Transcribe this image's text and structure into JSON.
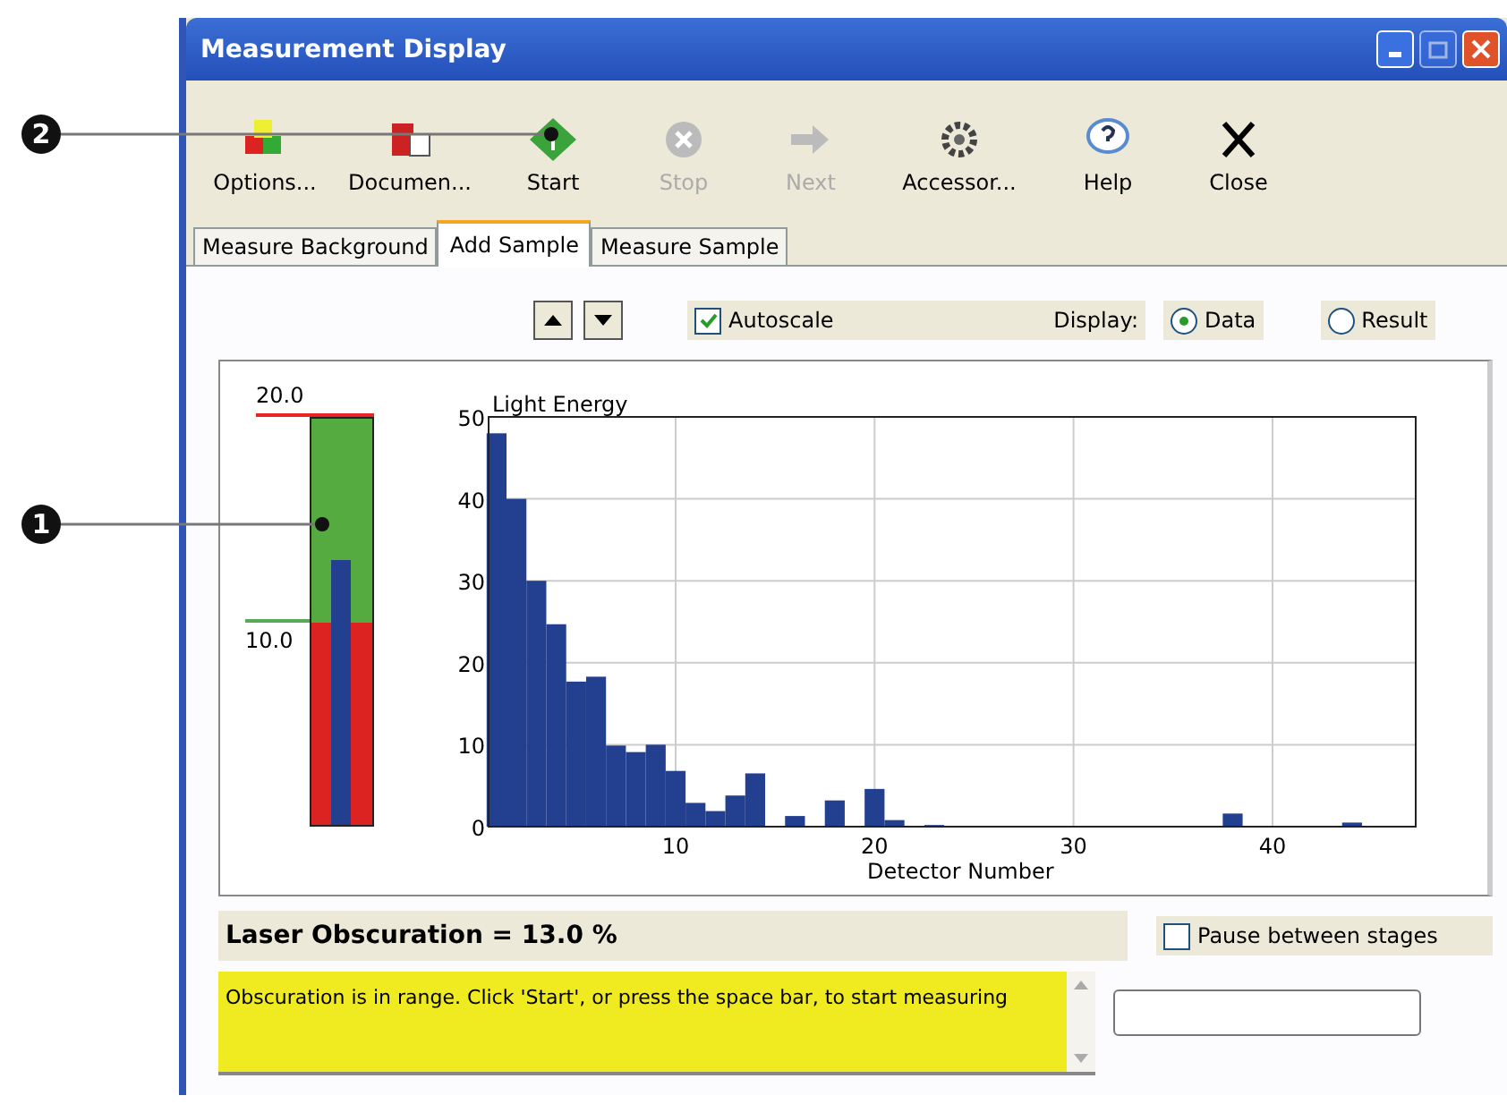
{
  "callouts": [
    {
      "number": "2"
    },
    {
      "number": "1"
    }
  ],
  "window": {
    "title": "Measurement Display"
  },
  "toolbar": [
    {
      "label": "Options...",
      "disabled": false
    },
    {
      "label": "Documen...",
      "disabled": false
    },
    {
      "label": "Start",
      "disabled": false
    },
    {
      "label": "Stop",
      "disabled": true
    },
    {
      "label": "Next",
      "disabled": true
    },
    {
      "label": "Accessor...",
      "disabled": false
    },
    {
      "label": "Help",
      "disabled": false
    },
    {
      "label": "Close",
      "disabled": false
    }
  ],
  "tabs": [
    {
      "label": "Measure Background",
      "selected": false
    },
    {
      "label": "Add Sample",
      "selected": true
    },
    {
      "label": "Measure Sample",
      "selected": false
    }
  ],
  "controls": {
    "autoscale": {
      "label": "Autoscale",
      "checked": true
    },
    "display_label": "Display:",
    "display_options": [
      {
        "label": "Data",
        "selected": true
      },
      {
        "label": "Result",
        "selected": false
      }
    ]
  },
  "gauge": {
    "top_label": "20.0",
    "threshold_label": "10.0",
    "level": 0.65
  },
  "chart": {
    "chart_data": {
      "type": "bar",
      "title": "Light Energy",
      "xlabel": "Detector Number",
      "x": [
        1,
        2,
        3,
        4,
        5,
        6,
        7,
        8,
        9,
        10,
        11,
        12,
        13,
        14,
        16,
        18,
        20,
        21,
        23,
        38,
        44
      ],
      "values": [
        48,
        40,
        30,
        24.7,
        17.7,
        18.3,
        9.9,
        9.1,
        10,
        6.8,
        2.9,
        1.9,
        3.8,
        6.5,
        1.3,
        3.2,
        4.6,
        0.8,
        0.2,
        1.6,
        0.5
      ],
      "grid": true,
      "xlim": [
        0.6,
        47.2
      ],
      "ylim": [
        0,
        50
      ],
      "xticks": [
        10,
        20,
        30,
        40
      ],
      "yticks": [
        0,
        10,
        20,
        30,
        40,
        50
      ]
    }
  },
  "obscuration": "Laser Obscuration = 13.0 %",
  "pause": {
    "label": "Pause between stages",
    "checked": false
  },
  "message": "Obscuration is in range. Click 'Start', or press the space bar, to start measuring"
}
